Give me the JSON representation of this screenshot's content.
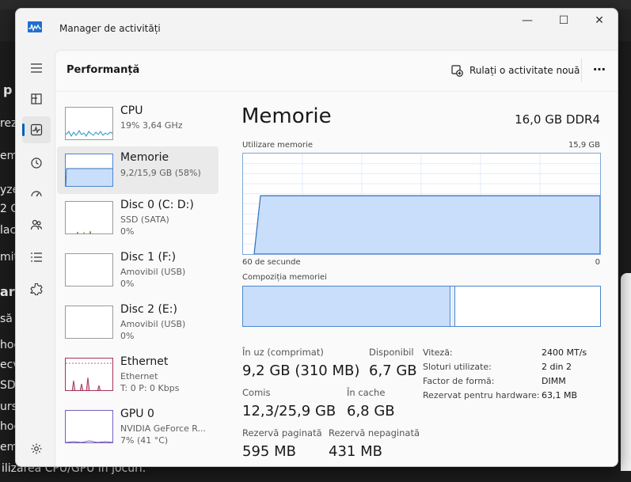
{
  "window": {
    "title": "Manager de activități",
    "minimize": "—",
    "maximize": "☐",
    "close": "✕"
  },
  "background_text": [
    "p",
    "rez",
    "em",
    "yze",
    "2 G",
    "lac",
    "mit",
    "ar",
    "să",
    "hoc",
    "ecv",
    "SD,",
    "urs",
    "hoc",
    "emp",
    "ilizarea CPU/GPU în jocuri."
  ],
  "rail": [
    "hamburger-icon",
    "processes-icon",
    "performance-icon",
    "history-icon",
    "startup-icon",
    "users-icon",
    "details-icon",
    "services-icon",
    "settings-icon"
  ],
  "header": {
    "title": "Performanță",
    "run_task": "Rulați o activitate nouă",
    "more": "⋯"
  },
  "devices": [
    {
      "name": "CPU",
      "sub1": "19% 3,64 GHz",
      "sub2": ""
    },
    {
      "name": "Memorie",
      "sub1": "9,2/15,9 GB (58%)",
      "sub2": ""
    },
    {
      "name": "Disc 0 (C: D:)",
      "sub1": "SSD (SATA)",
      "sub2": "0%"
    },
    {
      "name": "Disc 1 (F:)",
      "sub1": "Amovibil (USB)",
      "sub2": "0%"
    },
    {
      "name": "Disc 2 (E:)",
      "sub1": "Amovibil (USB)",
      "sub2": "0%"
    },
    {
      "name": "Ethernet",
      "sub1": "Ethernet",
      "sub2": "T: 0 P: 0 Kbps"
    },
    {
      "name": "GPU 0",
      "sub1": "NVIDIA GeForce R...",
      "sub2": "7% (41 °C)"
    }
  ],
  "memory": {
    "title": "Memorie",
    "spec": "16,0 GB DDR4",
    "usage_label": "Utilizare memorie",
    "usage_max": "15,9 GB",
    "time_left": "60 de secunde",
    "time_right": "0",
    "usage_fraction": 0.58,
    "composition_label": "Compoziția memoriei",
    "composition_in_use_fraction": 0.58,
    "composition_modified_fraction": 0.01,
    "stats": {
      "in_use_label": "În uz (comprimat)",
      "in_use_value": "9,2 GB (310 MB)",
      "available_label": "Disponibil",
      "available_value": "6,7 GB",
      "committed_label": "Comis",
      "committed_value": "12,3/25,9 GB",
      "cached_label": "În cache",
      "cached_value": "6,8 GB",
      "paged_label": "Rezervă paginată",
      "paged_value": "595 MB",
      "nonpaged_label": "Rezervă nepaginată",
      "nonpaged_value": "431 MB"
    },
    "details": [
      {
        "key": "Viteză:",
        "value": "2400 MT/s"
      },
      {
        "key": "Sloturi utilizate:",
        "value": "2 din 2"
      },
      {
        "key": "Factor de formă:",
        "value": "DIMM"
      },
      {
        "key": "Rezervat pentru hardware:",
        "value": "63,1 MB"
      }
    ]
  },
  "colors": {
    "accent": "#005fb8",
    "memory_fill": "#c9defa",
    "memory_line": "#2f6ebd",
    "cpu_line": "#2f9bc5",
    "ethernet_line": "#a5345a"
  }
}
